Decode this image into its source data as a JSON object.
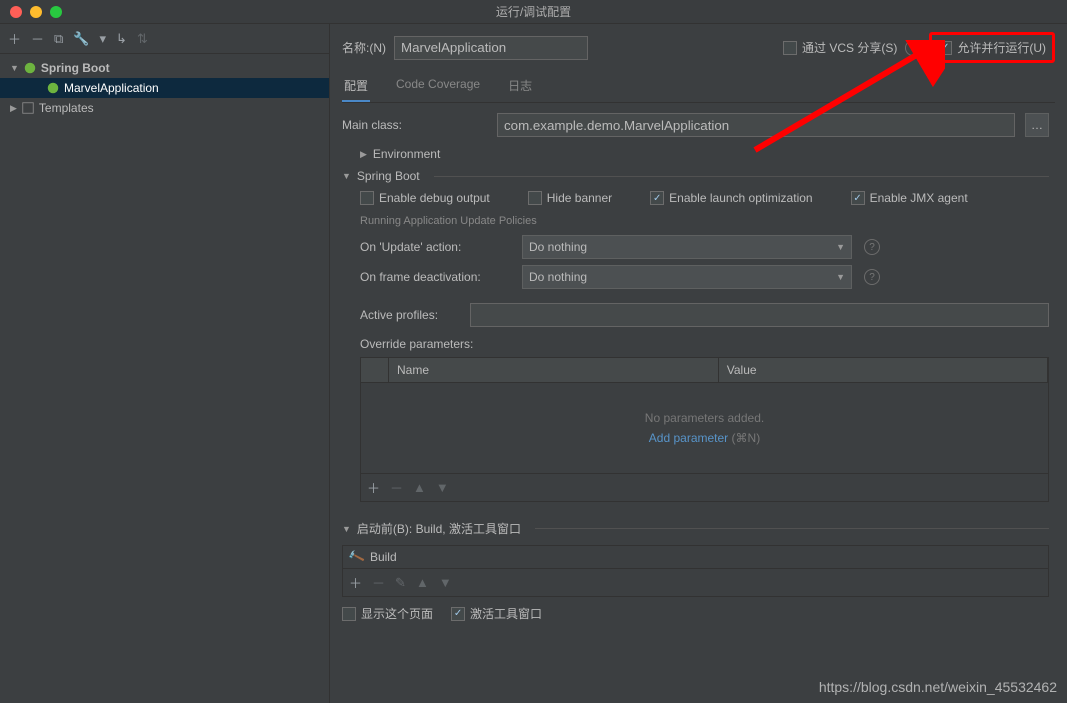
{
  "window": {
    "title": "运行/调试配置"
  },
  "tree": {
    "root": "Spring Boot",
    "child": "MarvelApplication",
    "templates": "Templates"
  },
  "form": {
    "name_label": "名称:(N)",
    "name_value": "MarvelApplication",
    "share_vcs": "通过 VCS 分享(S)",
    "allow_parallel": "允许并行运行(U)"
  },
  "tabs": {
    "config": "配置",
    "coverage": "Code Coverage",
    "logs": "日志"
  },
  "mainclass": {
    "label": "Main class:",
    "value": "com.example.demo.MarvelApplication"
  },
  "sections": {
    "environment": "Environment",
    "springboot": "Spring Boot"
  },
  "sb": {
    "enable_debug": "Enable debug output",
    "hide_banner": "Hide banner",
    "enable_launch": "Enable launch optimization",
    "enable_jmx": "Enable JMX agent",
    "policies_title": "Running Application Update Policies",
    "on_update": "On 'Update' action:",
    "on_frame": "On frame deactivation:",
    "do_nothing": "Do nothing",
    "active_profiles": "Active profiles:",
    "override_params": "Override parameters:"
  },
  "table": {
    "name": "Name",
    "value": "Value",
    "no_params": "No parameters added.",
    "add_param": "Add parameter",
    "shortcut": "(⌘N)"
  },
  "before": {
    "title": "启动前(B): Build, 激活工具窗口",
    "build": "Build",
    "show_page": "显示这个页面",
    "activate_tool": "激活工具窗口"
  },
  "watermark": "https://blog.csdn.net/weixin_45532462"
}
